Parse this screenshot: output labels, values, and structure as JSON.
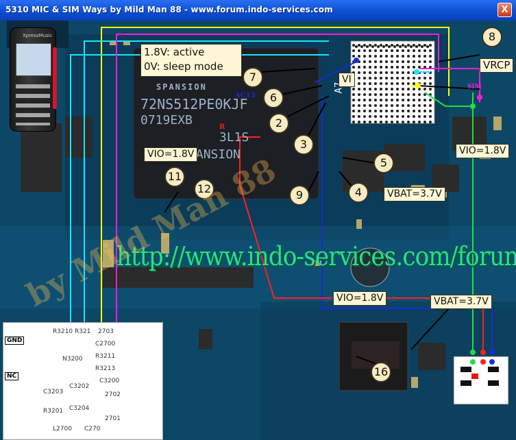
{
  "window": {
    "title": "5310 MIC & SIM Ways by Mild Man 88 - www.forum.indo-services.com",
    "close_label": "X"
  },
  "annotations": {
    "active_label": "1.8V: active",
    "sleep_label": "0V: sleep mode",
    "vio_left": "VIO=1.8V",
    "vio_right": "VIO=1.8V",
    "vio_bottom": "VIO=1.8V",
    "vbat_mid": "VBAT=3.7V",
    "vbat_bottom": "VBAT=3.7V",
    "vrcp": "VRCP",
    "vi": "VI",
    "numbers": [
      "8",
      "7",
      "6",
      "2",
      "3",
      "5",
      "4",
      "9",
      "11",
      "12",
      "16"
    ]
  },
  "chip": {
    "brand": "SPANSION",
    "line1": "72NS512PE0KJF",
    "line2": "0719EXB",
    "line3": "3L1S",
    "line4": "I106 SPANSION"
  },
  "board_labels": {
    "ac13": "AC13",
    "a7": "A7",
    "r": "R",
    "sim": "SIM"
  },
  "url_overlay": "http://www.indo-services.com/forum/",
  "watermark": "by Mild Man 88",
  "inset": {
    "gnd": "GND",
    "nc": "NC",
    "parts": [
      "R3210",
      "R321",
      "2703",
      "C2700",
      "N3200",
      "R3211",
      "R3213",
      "C3200",
      "C3202",
      "C3204",
      "C3203",
      "R3201",
      "L2700",
      "C270",
      "2702",
      "2701"
    ]
  },
  "phone": {
    "brand": "XpressMusic"
  },
  "colors": {
    "title_bar": "#0b4fd6",
    "board": "#0b3c5a",
    "magenta": "#ff1ad9",
    "cyan": "#19e6ff",
    "yellow": "#ffff00",
    "orange": "#ffa01a",
    "blue": "#1a2ad8",
    "red": "#ff2020",
    "green": "#20e040",
    "url_green": "#26e08c"
  }
}
